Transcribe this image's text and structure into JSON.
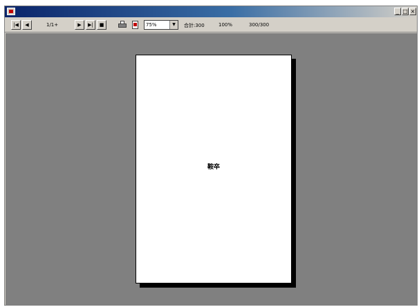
{
  "window": {
    "title": "",
    "controls": {
      "minimize": "_",
      "maximize": "□",
      "close": "×"
    }
  },
  "toolbar": {
    "first_page": "|◀",
    "prev_page": "◀",
    "page_indicator": "1/1+",
    "next_page": "▶",
    "last_page": "▶|",
    "stop": "■",
    "zoom": {
      "value": "75%",
      "arrow": "▼"
    },
    "status_total": "合計:300",
    "status_percent": "100%",
    "status_records": "300/300"
  },
  "icons": {
    "app": "app-icon",
    "print": "printer-icon",
    "export": "export-icon"
  },
  "colors": {
    "title_start": "#0a246a",
    "title_end": "#d4d0c8",
    "chrome": "#d4d0c8",
    "viewer_background": "#808080",
    "page": "#ffffff"
  },
  "document": {
    "page_text": "鞍卒"
  }
}
